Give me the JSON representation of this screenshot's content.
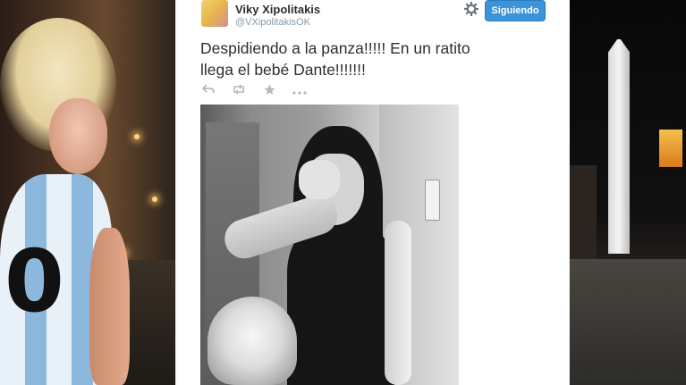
{
  "tweet": {
    "display_name": "Viky Xipolitakis",
    "username": "@VXipolitakisOK",
    "follow_button_label": "Siguiendo",
    "text_line1": "Despidiendo a la panza!!!!! En un ratito",
    "text_line2": "llega el bebé Dante!!!!!!!",
    "icons": {
      "settings": "gear-icon",
      "reply": "reply-icon",
      "retweet": "retweet-icon",
      "favorite": "star-icon",
      "more": "more-icon"
    },
    "colors": {
      "follow_button": "#3b94d9",
      "name_text": "#292f33",
      "secondary_text": "#8899a6",
      "action_icons": "#b1bbc3"
    }
  },
  "background": {
    "jersey_number": "0"
  }
}
